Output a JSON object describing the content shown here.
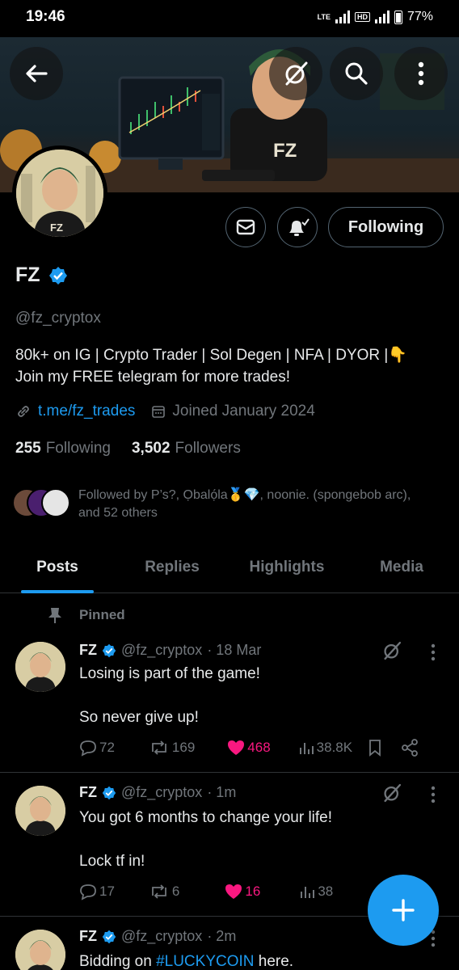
{
  "status_bar": {
    "time": "19:46",
    "network": "LTE",
    "hd": "HD",
    "battery": "77%"
  },
  "profile": {
    "name": "FZ",
    "handle": "@fz_cryptox",
    "bio_line1": "80k+ on IG | Crypto Trader | Sol Degen | NFA | DYOR |👇",
    "bio_line2": "Join my FREE telegram for more trades!",
    "link": "t.me/fz_trades",
    "joined": "Joined January 2024",
    "following_count": "255",
    "following_label": "Following",
    "followers_count": "3,502",
    "followers_label": "Followers",
    "followed_by_line1": "Followed by P’s?, Ọbalọ́la🥇💎, noonie. (spongebob arc),",
    "followed_by_line2": "and 52 others",
    "banner_logo": "FZ",
    "avatar_logo": "FZ"
  },
  "actions": {
    "following_button": "Following"
  },
  "tabs": [
    {
      "label": "Posts",
      "active": true
    },
    {
      "label": "Replies",
      "active": false
    },
    {
      "label": "Highlights",
      "active": false
    },
    {
      "label": "Media",
      "active": false
    }
  ],
  "pinned_label": "Pinned",
  "tweets": [
    {
      "name": "FZ",
      "handle": "@fz_cryptox",
      "time": "· 18 Mar",
      "line1": "Losing is part of the game!",
      "line2": "So never give up!",
      "replies": "72",
      "retweets": "169",
      "likes": "468",
      "views": "38.8K"
    },
    {
      "name": "FZ",
      "handle": "@fz_cryptox",
      "time": "· 1m",
      "line1": "You got 6 months to change your life!",
      "line2": "Lock tf in!",
      "replies": "17",
      "retweets": "6",
      "likes": "16",
      "views": "38"
    },
    {
      "name": "FZ",
      "handle": "@fz_cryptox",
      "time": "· 2m",
      "line1_prefix": "Bidding on ",
      "line1_tag": "#LUCKYCOIN",
      "line1_suffix": " here."
    }
  ],
  "colors": {
    "accent": "#1d9bf0",
    "like": "#f91880",
    "muted": "#71767b",
    "background": "#000000"
  }
}
